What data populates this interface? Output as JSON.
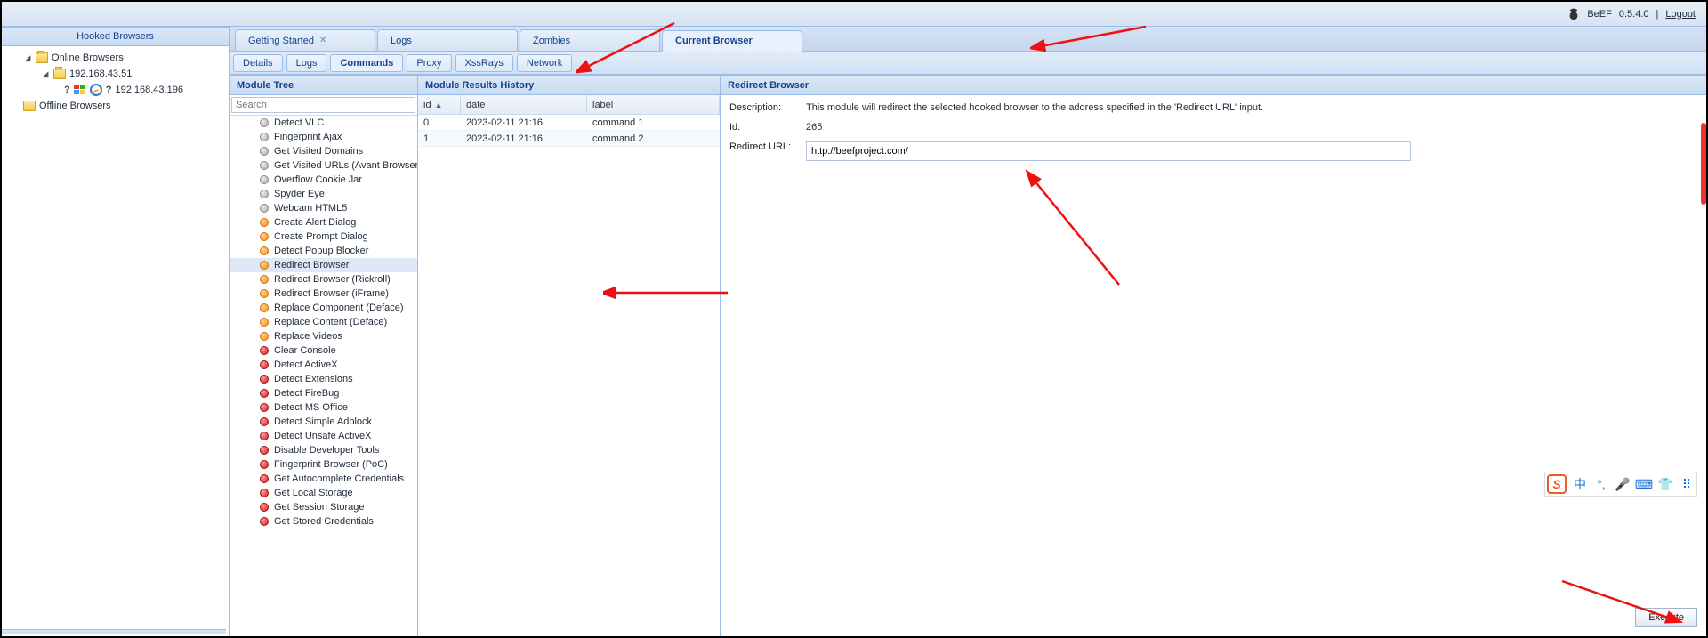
{
  "header": {
    "app": "BeEF",
    "version": "0.5.4.0",
    "logout": "Logout"
  },
  "left": {
    "title": "Hooked Browsers",
    "online_label": "Online Browsers",
    "offline_label": "Offline Browsers",
    "ip1": "192.168.43.51",
    "ip2": "192.168.43.196"
  },
  "tabs": {
    "t0": "Getting Started",
    "t1": "Logs",
    "t2": "Zombies",
    "t3": "Current Browser"
  },
  "subtabs": {
    "s0": "Details",
    "s1": "Logs",
    "s2": "Commands",
    "s3": "Proxy",
    "s4": "XssRays",
    "s5": "Network"
  },
  "moduleTree": {
    "title": "Module Tree",
    "search_placeholder": "Search",
    "items": [
      {
        "c": "gray",
        "t": "Detect VLC"
      },
      {
        "c": "gray",
        "t": "Fingerprint Ajax"
      },
      {
        "c": "gray",
        "t": "Get Visited Domains"
      },
      {
        "c": "gray",
        "t": "Get Visited URLs (Avant Browser)"
      },
      {
        "c": "gray",
        "t": "Overflow Cookie Jar"
      },
      {
        "c": "gray",
        "t": "Spyder Eye"
      },
      {
        "c": "gray",
        "t": "Webcam HTML5"
      },
      {
        "c": "orange",
        "t": "Create Alert Dialog"
      },
      {
        "c": "orange",
        "t": "Create Prompt Dialog"
      },
      {
        "c": "orange",
        "t": "Detect Popup Blocker"
      },
      {
        "c": "orange",
        "t": "Redirect Browser",
        "sel": true
      },
      {
        "c": "orange",
        "t": "Redirect Browser (Rickroll)"
      },
      {
        "c": "orange",
        "t": "Redirect Browser (iFrame)"
      },
      {
        "c": "orange",
        "t": "Replace Component (Deface)"
      },
      {
        "c": "orange",
        "t": "Replace Content (Deface)"
      },
      {
        "c": "orange",
        "t": "Replace Videos"
      },
      {
        "c": "red",
        "t": "Clear Console"
      },
      {
        "c": "red",
        "t": "Detect ActiveX"
      },
      {
        "c": "red",
        "t": "Detect Extensions"
      },
      {
        "c": "red",
        "t": "Detect FireBug"
      },
      {
        "c": "red",
        "t": "Detect MS Office"
      },
      {
        "c": "red",
        "t": "Detect Simple Adblock"
      },
      {
        "c": "red",
        "t": "Detect Unsafe ActiveX"
      },
      {
        "c": "red",
        "t": "Disable Developer Tools"
      },
      {
        "c": "red",
        "t": "Fingerprint Browser (PoC)"
      },
      {
        "c": "red",
        "t": "Get Autocomplete Credentials"
      },
      {
        "c": "red",
        "t": "Get Local Storage"
      },
      {
        "c": "red",
        "t": "Get Session Storage"
      },
      {
        "c": "red",
        "t": "Get Stored Credentials"
      }
    ]
  },
  "results": {
    "title": "Module Results History",
    "h_id": "id",
    "h_date": "date",
    "h_label": "label",
    "rows": [
      {
        "id": "0",
        "date": "2023-02-11 21:16",
        "label": "command 1"
      },
      {
        "id": "1",
        "date": "2023-02-11 21:16",
        "label": "command 2"
      }
    ]
  },
  "detail": {
    "title": "Redirect Browser",
    "l_desc": "Description:",
    "v_desc": "This module will redirect the selected hooked browser to the address specified in the 'Redirect URL' input.",
    "l_id": "Id:",
    "v_id": "265",
    "l_url": "Redirect URL:",
    "v_url": "http://beefproject.com/",
    "execute": "Execute"
  },
  "ime": {
    "zh": "中"
  }
}
